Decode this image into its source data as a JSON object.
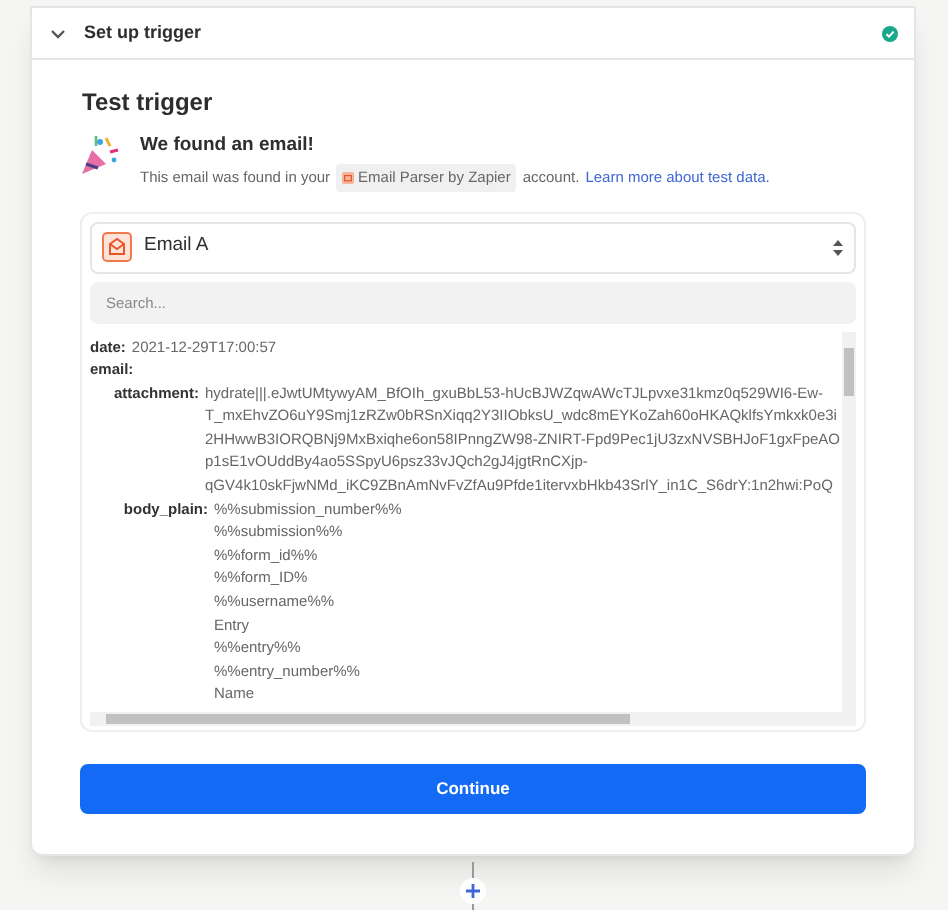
{
  "step": {
    "title": "Set up trigger",
    "expanded": true,
    "complete": true
  },
  "section_title": "Test trigger",
  "found": {
    "heading": "We found an email!",
    "text_before": "This email was found in your",
    "app_chip": "Email Parser by Zapier",
    "text_after": "account.",
    "link": "Learn more about test data."
  },
  "record_select": {
    "value": "Email A"
  },
  "search": {
    "placeholder": "Search..."
  },
  "fields": [
    {
      "key": "date:",
      "lines": [
        "2021-12-29T17:00:57"
      ]
    },
    {
      "key": "email:",
      "children": [
        {
          "key": "attachment:",
          "lines": [
            "hydrate|||.eJwtUMtywyAM_BfOIh_gxuBbL53-hUcBJWZqwAWcTJLpvxe31kmz0q529WI6-Ew-",
            "T_mxEhvZO6uY9Smj1zRZw0bRSnXiqq2Y3IIObksU_wdc8mEYKoZah60oHKAQklfsYmkxk0e3i",
            "2HHwwB3IORQBNj9MxBxiqhe6on58IPnngZW98-ZNIRT-Fpd9Pec1jU3zxNVSBHJoF1gxFpeAO",
            "p1sE1vOUddBy4ao5SSpyU6psz33vJQch2gJ4jgtRnCXjp-",
            "qGV4k10skFjwNMd_iKC9ZBnAmNvFvZfAu9Pfde1itervxbHkb43SrlY_in1C_S6drY:1n2hwi:PoQ"
          ]
        },
        {
          "key": "body_plain:",
          "lines": [
            "%%submission_number%%",
            "%%submission%%",
            "%%form_id%%",
            "%%form_ID%",
            "%%username%%",
            "Entry",
            "%%entry%%",
            "%%entry_number%%",
            "Name"
          ]
        }
      ]
    }
  ],
  "continue_button": "Continue"
}
